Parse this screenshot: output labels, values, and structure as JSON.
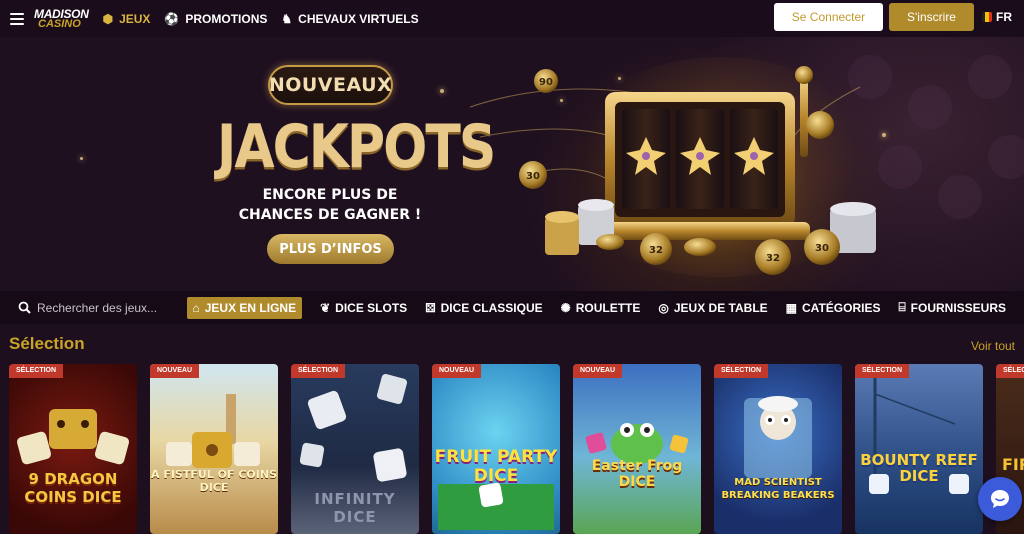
{
  "header": {
    "menu_icon": "hamburger-icon",
    "logo_line1": "MADISON",
    "logo_line2": "CASINO",
    "nav": [
      {
        "label": "JEUX",
        "icon": "dice-icon",
        "active": true
      },
      {
        "label": "PROMOTIONS",
        "icon": "soccer-ball-icon",
        "active": false
      },
      {
        "label": "CHEVAUX VIRTUELS",
        "icon": "horse-icon",
        "active": false
      }
    ],
    "login_label": "Se Connecter",
    "signup_label": "S'inscrire",
    "language": "FR"
  },
  "hero": {
    "tag": "NOUVEAUX",
    "title": "JACKPOTS",
    "subtitle_line1": "ENCORE PLUS DE",
    "subtitle_line2": "CHANCES DE GAGNER !",
    "cta_label": "PLUS D’INFOS",
    "chips": [
      "90",
      "30",
      "32",
      "30",
      "32"
    ]
  },
  "categories": {
    "search_placeholder": "Rechercher des jeux...",
    "items": [
      {
        "label": "JEUX EN LIGNE",
        "icon": "home-icon",
        "active": true
      },
      {
        "label": "DICE SLOTS",
        "icon": "cherry-icon",
        "active": false
      },
      {
        "label": "DICE CLASSIQUE",
        "icon": "dice-icon",
        "active": false
      },
      {
        "label": "ROULETTE",
        "icon": "roulette-icon",
        "active": false
      },
      {
        "label": "JEUX DE TABLE",
        "icon": "chip-icon",
        "active": false
      },
      {
        "label": "CATÉGORIES",
        "icon": "grid-icon",
        "active": false
      },
      {
        "label": "FOURNISSEURS",
        "icon": "building-icon",
        "active": false
      }
    ]
  },
  "selection": {
    "title": "Sélection",
    "see_all": "Voir tout",
    "games": [
      {
        "badge": "SÉLECTION",
        "title": "9 DRAGON COINS DICE"
      },
      {
        "badge": "NOUVEAU",
        "title": "A FISTFUL OF COINS DICE"
      },
      {
        "badge": "SÉLECTION",
        "title": "INFINITY DICE"
      },
      {
        "badge": "NOUVEAU",
        "title": "FRUIT PARTY DICE"
      },
      {
        "badge": "NOUVEAU",
        "title": "Easter Frog DICE"
      },
      {
        "badge": "SÉLECTION",
        "title": "MAD SCIENTIST BREAKING BEAKERS"
      },
      {
        "badge": "SÉLECTION",
        "title": "BOUNTY REEF DICE"
      },
      {
        "badge": "SÉLECTION",
        "title": "FIRE"
      }
    ]
  },
  "chat": {
    "icon": "chat-bubble-icon"
  }
}
